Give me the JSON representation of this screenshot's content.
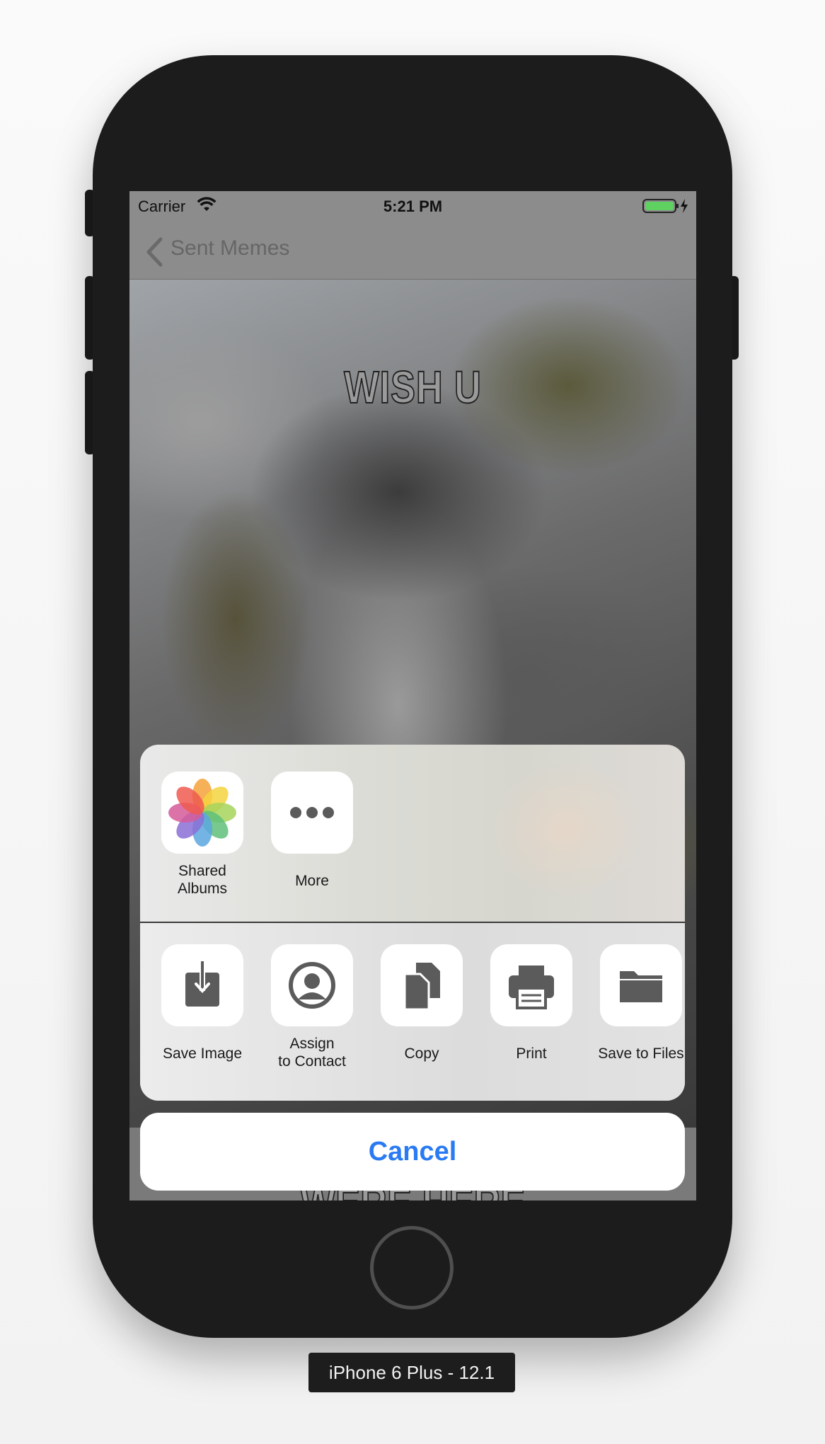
{
  "status_bar": {
    "carrier": "Carrier",
    "time": "5:21 PM",
    "wifi_icon": "wifi-icon",
    "battery_icon": "battery-charging-icon",
    "battery_color": "#5fd160"
  },
  "nav_bar": {
    "back_label": "Sent Memes",
    "back_icon": "chevron-left-icon"
  },
  "meme": {
    "top_text": "WISH U",
    "bottom_text": "WERE HERE"
  },
  "share_sheet": {
    "row1": [
      {
        "label": "Shared\nAlbums",
        "icon": "photos-icon"
      },
      {
        "label": "More",
        "icon": "more-icon"
      }
    ],
    "row2": [
      {
        "label": "Save Image",
        "icon": "save-image-icon"
      },
      {
        "label": "Assign\nto Contact",
        "icon": "contact-icon"
      },
      {
        "label": "Copy",
        "icon": "copy-icon"
      },
      {
        "label": "Print",
        "icon": "print-icon"
      },
      {
        "label": "Save to Files",
        "icon": "folder-icon"
      }
    ],
    "cancel_label": "Cancel",
    "cancel_color": "#2a7af3"
  },
  "device_label": "iPhone 6 Plus - 12.1"
}
